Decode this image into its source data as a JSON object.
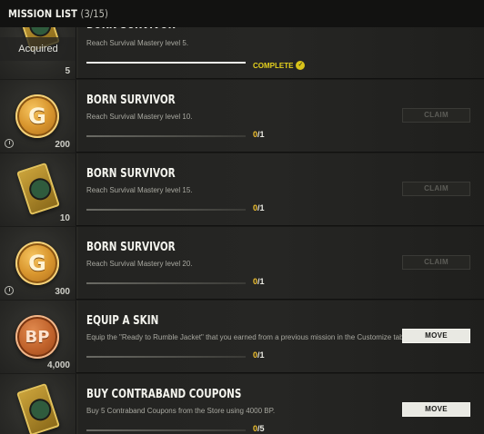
{
  "header": {
    "title": "MISSION LIST",
    "count": "(3/15)"
  },
  "missions": [
    {
      "title": "BORN SURVIVOR",
      "description": "Reach Survival Mastery level 5.",
      "reward": "5",
      "status": "COMPLETE",
      "acquired": "Acquired",
      "progress_fraction": 1.0
    },
    {
      "title": "BORN SURVIVOR",
      "description": "Reach Survival Mastery level 10.",
      "reward": "200",
      "reward_icon": "g-coin-icon",
      "current": "0",
      "total": "/1",
      "button": "CLAIM",
      "progress_fraction": 0
    },
    {
      "title": "BORN SURVIVOR",
      "description": "Reach Survival Mastery level 15.",
      "reward": "10",
      "reward_icon": "contraband-coupon-icon",
      "current": "0",
      "total": "/1",
      "button": "CLAIM",
      "progress_fraction": 0
    },
    {
      "title": "BORN SURVIVOR",
      "description": "Reach Survival Mastery level 20.",
      "reward": "300",
      "reward_icon": "g-coin-icon",
      "current": "0",
      "total": "/1",
      "button": "CLAIM",
      "progress_fraction": 0
    },
    {
      "title": "EQUIP A SKIN",
      "description": "Equip the \"Ready to Rumble Jacket\" that you earned from a previous mission in the Customize tab.",
      "reward": "4,000",
      "reward_icon": "bp-coin-icon",
      "current": "0",
      "total": "/1",
      "button": "MOVE",
      "progress_fraction": 0
    },
    {
      "title": "BUY CONTRABAND COUPONS",
      "description": "Buy 5 Contraband Coupons from the Store using 4000 BP.",
      "reward": "",
      "reward_icon": "contraband-coupon-icon",
      "current": "0",
      "total": "/5",
      "button": "MOVE",
      "progress_fraction": 0
    }
  ],
  "coin_labels": {
    "g": "G",
    "bp": "BP"
  },
  "check_glyph": "✓"
}
